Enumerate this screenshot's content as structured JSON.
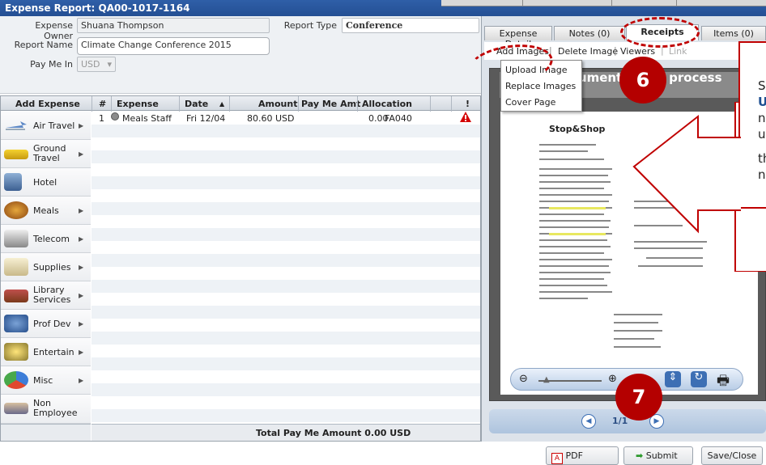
{
  "window": {
    "title": "Expense Report: QA00-1017-1164"
  },
  "form": {
    "owner_label": "Expense Owner",
    "owner_value": "Shuana Thompson",
    "report_type_label": "Report Type",
    "report_type_value": "Conference",
    "report_name_label": "Report Name",
    "report_name_value": "Climate Change Conference 2015",
    "pay_me_in_label": "Pay Me In",
    "pay_me_in_value": "USD"
  },
  "grid": {
    "add_expense_header": "Add Expense",
    "columns": [
      "#",
      "Expense",
      "Date",
      "Amount",
      "Pay Me Amt",
      "Allocation",
      "!"
    ],
    "rows": [
      {
        "num": "1",
        "expense": "Meals Staff",
        "date": "Fri 12/04",
        "amount": "80.60 USD",
        "pay_me": "0.00",
        "allocation": "FA040"
      }
    ],
    "total_label": "Total Pay Me Amount 0.00 USD"
  },
  "sidebar": {
    "items": [
      {
        "label": "Air Travel",
        "icon": "airplane-icon"
      },
      {
        "label": "Ground Travel",
        "icon": "taxi-icon"
      },
      {
        "label": "Hotel",
        "icon": "hotel-icon"
      },
      {
        "label": "Meals",
        "icon": "burger-icon"
      },
      {
        "label": "Telecom",
        "icon": "phone-icon"
      },
      {
        "label": "Supplies",
        "icon": "supplies-icon"
      },
      {
        "label": "Library Services",
        "icon": "books-icon"
      },
      {
        "label": "Prof Dev",
        "icon": "person-icon"
      },
      {
        "label": "Entertain",
        "icon": "entertain-icon"
      },
      {
        "label": "Misc",
        "icon": "shapes-icon"
      },
      {
        "label": "Non Employee",
        "icon": "handshake-icon"
      }
    ]
  },
  "tabs": {
    "expense_detail": "Expense Detail",
    "notes": "Notes (0)",
    "receipts": "Receipts",
    "items": "Items (0)"
  },
  "receipt_toolbar": {
    "add_images": "Add Images",
    "delete_image": "Delete Image",
    "viewers": "Viewers",
    "link": "Link"
  },
  "dropdown": {
    "upload": "Upload Image",
    "replace": "Replace Images",
    "cover": "Cover Page"
  },
  "viewer": {
    "overlay_text": "cument being process",
    "page_indicator": "1/1",
    "store_name": "Stop&Shop"
  },
  "callouts": {
    "badge_6": "6",
    "badge_7": "7",
    "text_1a": "S",
    "text_1b": "U",
    "text_1c": "n",
    "text_1d": "u",
    "text_2a": "th",
    "text_2b": "n"
  },
  "footer": {
    "pdf": "PDF Report",
    "submit": "Submit",
    "save_close": "Save/Close"
  }
}
